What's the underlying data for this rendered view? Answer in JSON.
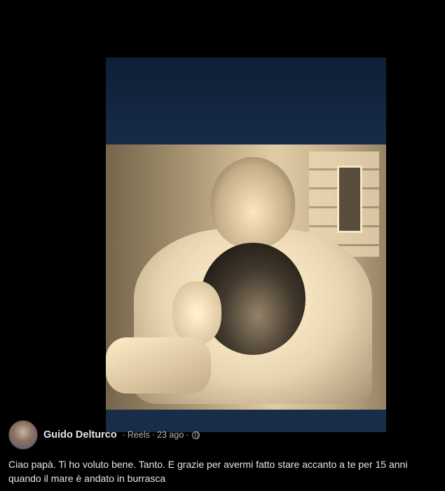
{
  "post": {
    "author": "Guido Delturco",
    "separator1": "·",
    "source": "Reels",
    "separator2": "·",
    "date": "23 ago",
    "separator3": "·",
    "privacy_icon": "globe-icon",
    "caption": "Ciao papà. Ti ho voluto bene. Tanto. E grazie per avermi fatto stare accanto a te per 15 anni  quando il mare è andato in burrasca"
  },
  "colors": {
    "background": "#000000",
    "text_primary": "#e4e6eb",
    "text_secondary": "#b0b3b8"
  }
}
